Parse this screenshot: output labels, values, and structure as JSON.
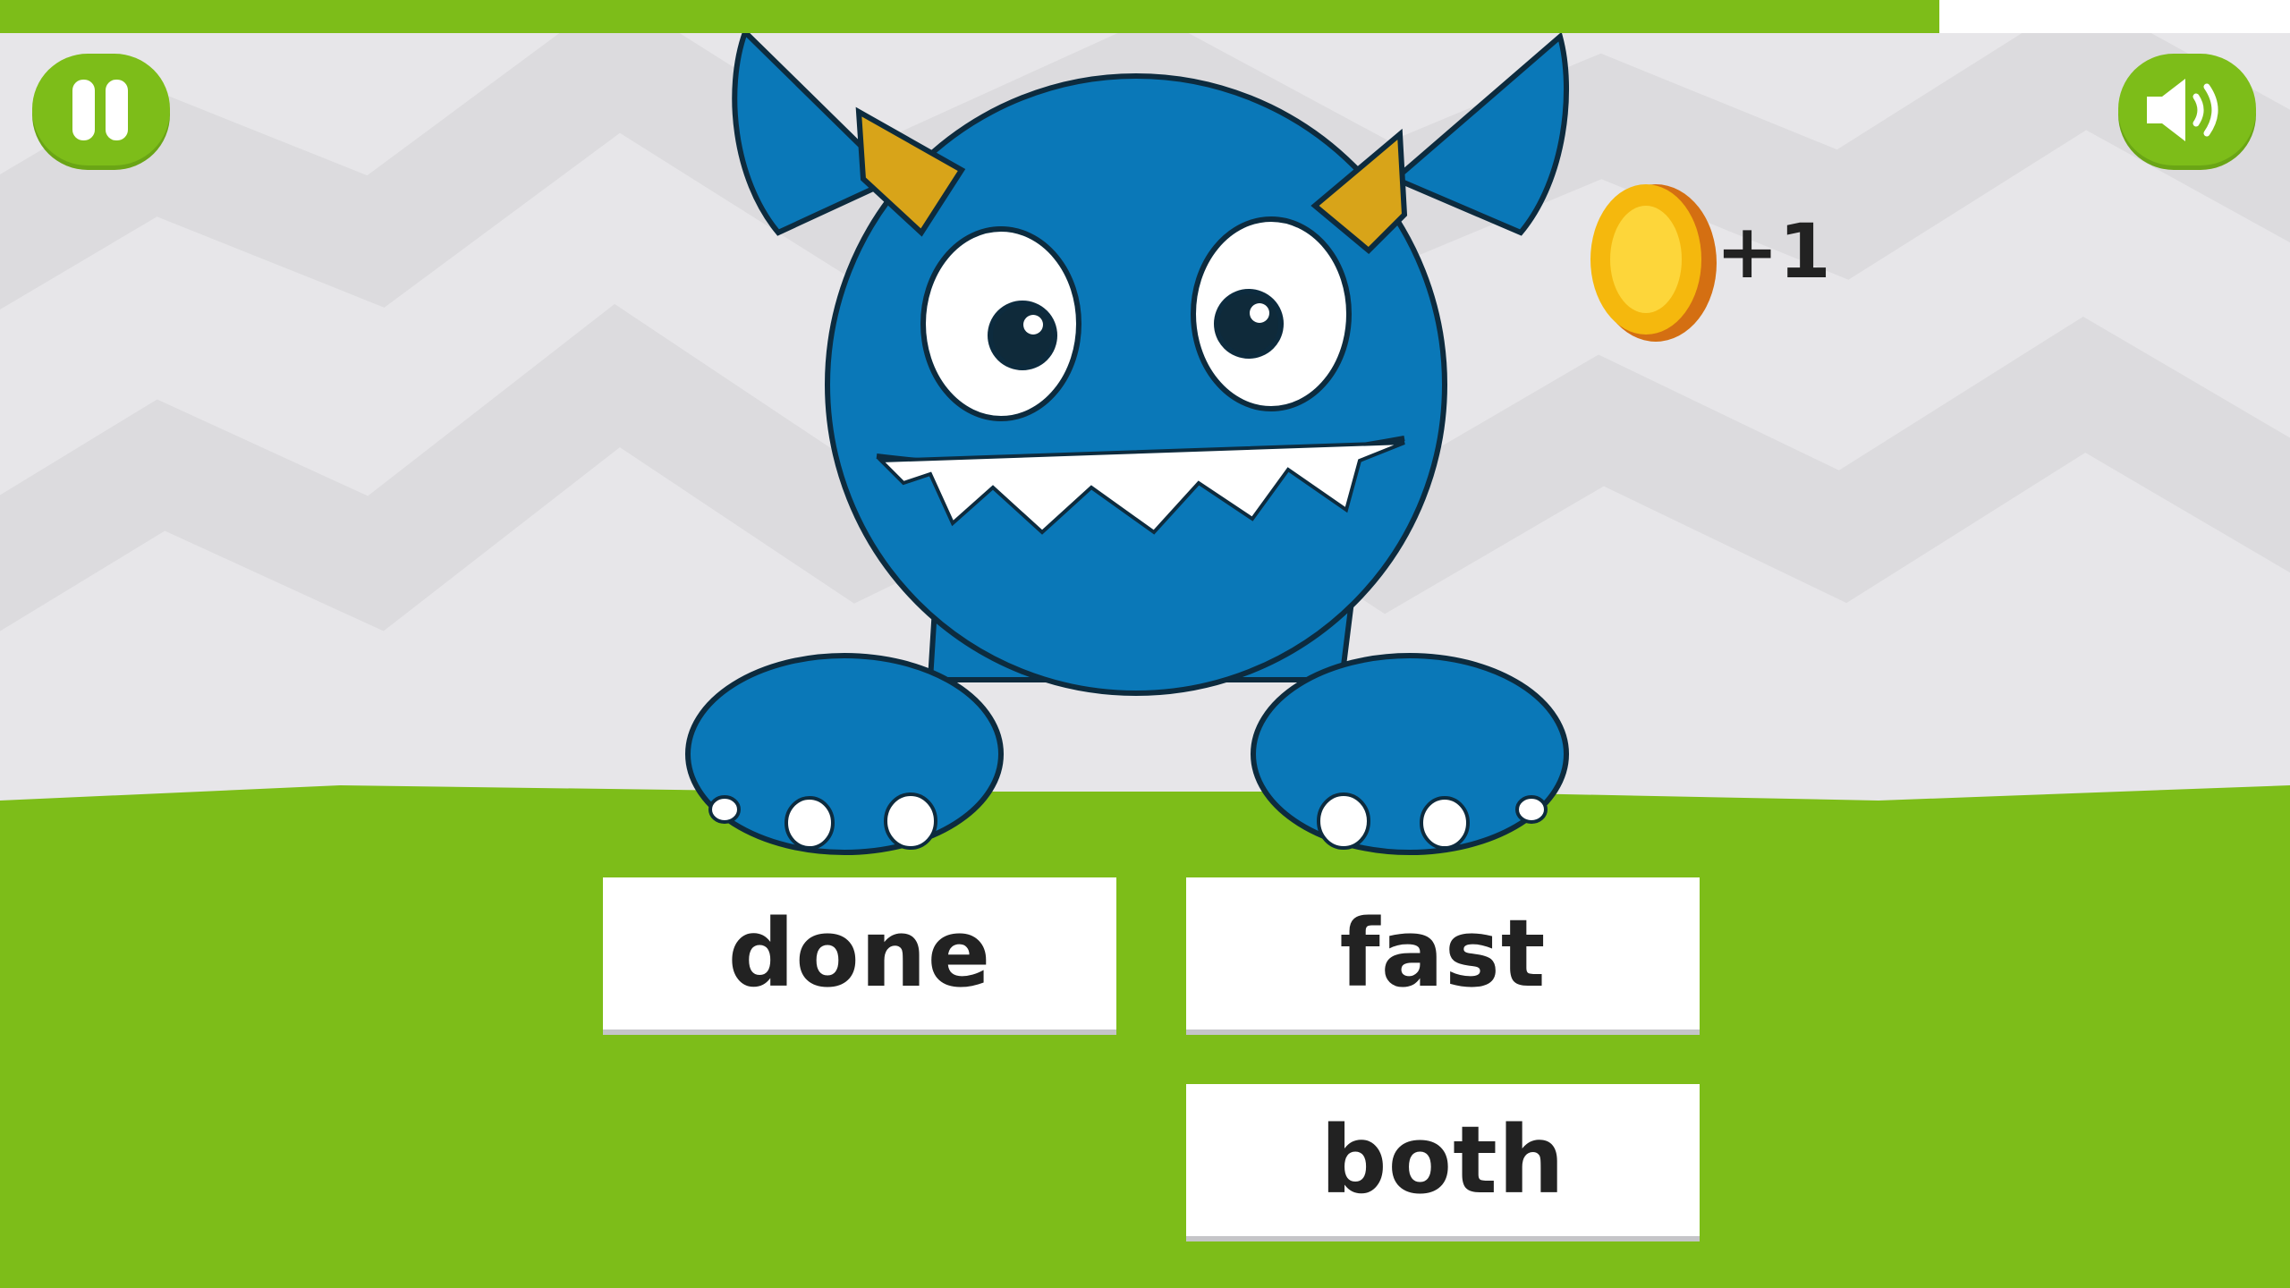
{
  "progress": {
    "fraction": 0.847,
    "color": "#7dbd19"
  },
  "controls": {
    "pause": "pause-icon",
    "sound": "speaker-icon"
  },
  "reward": {
    "icon": "coin-icon",
    "label": "+1"
  },
  "answers": [
    {
      "label": "done"
    },
    {
      "label": "fast"
    },
    {
      "label": "both"
    }
  ]
}
